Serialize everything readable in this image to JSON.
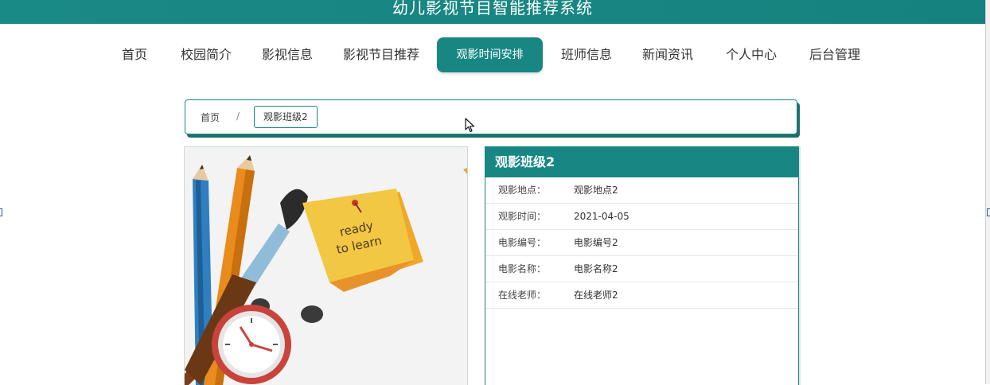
{
  "header": {
    "title": "幼儿影视节目智能推荐系统"
  },
  "nav": {
    "items": [
      {
        "label": "首页"
      },
      {
        "label": "校园简介"
      },
      {
        "label": "影视信息"
      },
      {
        "label": "影视节目推荐"
      },
      {
        "label": "观影时间安排",
        "active": true
      },
      {
        "label": "班师信息"
      },
      {
        "label": "新闻资讯"
      },
      {
        "label": "个人中心"
      },
      {
        "label": "后台管理"
      }
    ]
  },
  "breadcrumb": {
    "home": "首页",
    "separator": "/",
    "current": "观影班级2"
  },
  "image": {
    "note_line1": "ready",
    "note_line2": "to learn"
  },
  "detail": {
    "title": "观影班级2",
    "rows": [
      {
        "label": "观影地点：",
        "value": "观影地点2"
      },
      {
        "label": "观影时间：",
        "value": "2021-04-05"
      },
      {
        "label": "电影编号：",
        "value": "电影编号2"
      },
      {
        "label": "电影名称：",
        "value": "电影名称2"
      },
      {
        "label": "在线老师：",
        "value": "在线老师2"
      }
    ]
  },
  "colors": {
    "primary": "#188784",
    "header_bg": "#1a8a86",
    "note_yellow": "#f2c744"
  }
}
